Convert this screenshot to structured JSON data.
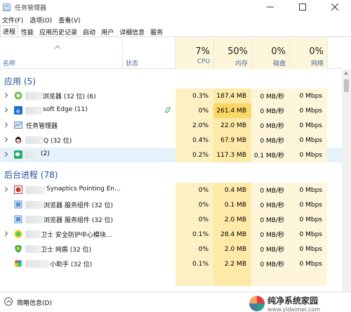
{
  "window": {
    "title": "任务管理器"
  },
  "menu": [
    {
      "label": "文件(F)"
    },
    {
      "label": "选项(O)"
    },
    {
      "label": "查看(V)"
    }
  ],
  "tabs": [
    {
      "label": "进程"
    },
    {
      "label": "性能"
    },
    {
      "label": "应用历史记录"
    },
    {
      "label": "启动"
    },
    {
      "label": "用户"
    },
    {
      "label": "详细信息"
    },
    {
      "label": "服务"
    }
  ],
  "header": {
    "name": "名称",
    "status": "状态",
    "cpu": {
      "pct": "7%",
      "label": "CPU"
    },
    "mem": {
      "pct": "50%",
      "label": "内存"
    },
    "disk": {
      "pct": "0%",
      "label": "磁盘"
    },
    "net": {
      "pct": "0%",
      "label": "网络"
    }
  },
  "groups": {
    "apps": "应用 (5)",
    "background": "后台进程 (78)"
  },
  "apps": [
    {
      "name": " 浏览器 (32 位) (6)",
      "icon": "browser-icon",
      "cpu": "0.3%",
      "mem": "187.4 MB",
      "disk": "0 MB/秒",
      "net": "0 Mbps"
    },
    {
      "name": "soft Edge (11)",
      "icon": "edge-icon",
      "cpu": "0%",
      "mem": "261.4 MB",
      "disk": "0 MB/秒",
      "net": "0 Mbps"
    },
    {
      "name": "任务管理器",
      "icon": "task-manager-icon",
      "cpu": "2.0%",
      "mem": "22.0 MB",
      "disk": "0 MB/秒",
      "net": "0 Mbps"
    },
    {
      "name": "Q (32 位)",
      "icon": "qq-icon",
      "cpu": "0.4%",
      "mem": "67.9 MB",
      "disk": "0 MB/秒",
      "net": "0 Mbps"
    },
    {
      "name": "(2)",
      "icon": "wechat-icon",
      "cpu": "0.2%",
      "mem": "117.3 MB",
      "disk": "0.1 MB/秒",
      "net": "0 Mbps"
    }
  ],
  "background": [
    {
      "name": "Synaptics Pointing En...",
      "icon": "synaptics-icon",
      "cpu": "0%",
      "mem": "0.4 MB",
      "disk": "0 MB/秒",
      "net": "0 Mbps"
    },
    {
      "name": "浏览器 服务组件 (32 位)",
      "icon": "browser-service-icon",
      "cpu": "0%",
      "mem": "0.1 MB",
      "disk": "0 MB/秒",
      "net": "0 Mbps"
    },
    {
      "name": "浏览器 服务组件 (32 位)",
      "icon": "browser-service-icon",
      "cpu": "0%",
      "mem": "2.0 MB",
      "disk": "0 MB/秒",
      "net": "0 Mbps"
    },
    {
      "name": "卫士 安全防护中心模块...",
      "icon": "guard-icon",
      "cpu": "0.1%",
      "mem": "28.4 MB",
      "disk": "0 MB/秒",
      "net": "0 Mbps"
    },
    {
      "name": "卫士 网盾 (32 位)",
      "icon": "shield-icon",
      "cpu": "0%",
      "mem": "2.0 MB",
      "disk": "0 MB/秒",
      "net": "0 Mbps"
    },
    {
      "name": "小助手 (32 位)",
      "icon": "assistant-icon",
      "cpu": "0.1%",
      "mem": "2.2 MB",
      "disk": "0 MB/秒",
      "net": "0 Mbps"
    }
  ],
  "footer": {
    "fewer_details": "简略信息(D)",
    "watermark_name": "纯净系统家园",
    "watermark_url": "www.yidaimei.com"
  },
  "colors": {
    "accent": "#1f4e9e",
    "cpu_bg": "#fdf1c4",
    "mem_bg": "#fde9a8",
    "mem_high": "#fbd766",
    "selected_row": "#e5f1fb"
  }
}
